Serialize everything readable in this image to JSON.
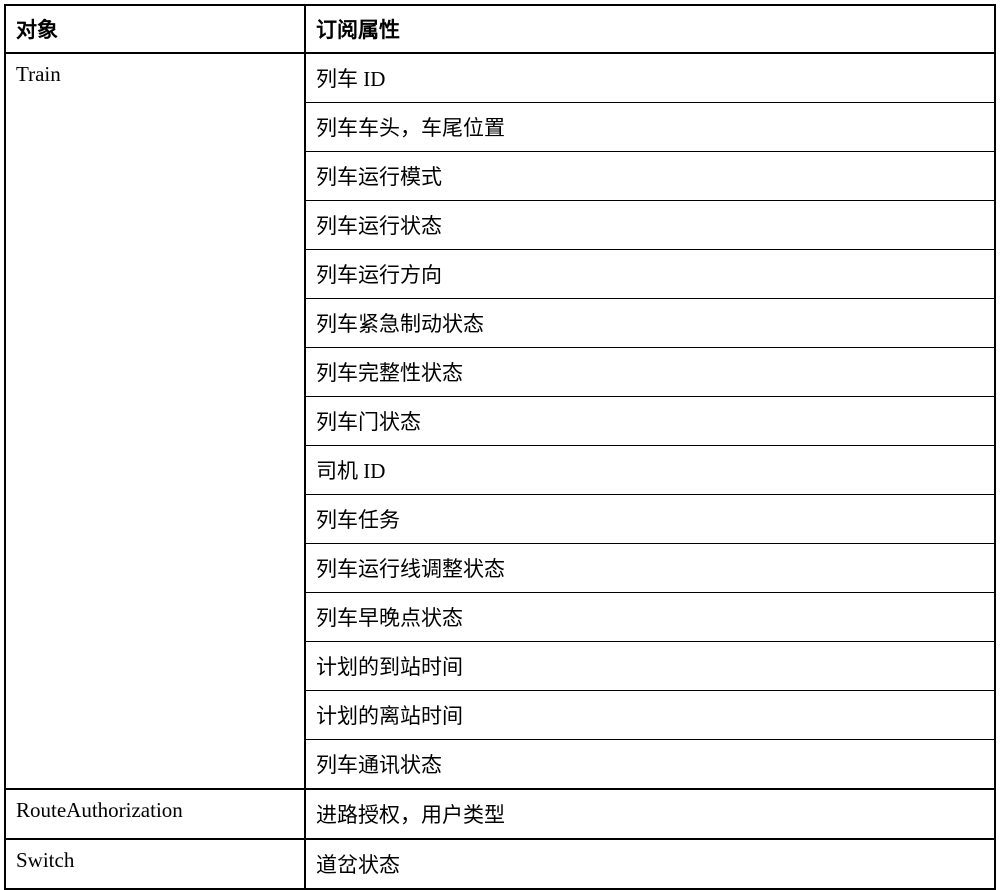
{
  "header": {
    "object_label": "对象",
    "attribute_label": "订阅属性"
  },
  "rows": [
    {
      "object": "Train",
      "attributes": [
        "列车 ID",
        "列车车头，车尾位置",
        "列车运行模式",
        "列车运行状态",
        "列车运行方向",
        "列车紧急制动状态",
        "列车完整性状态",
        "列车门状态",
        "司机 ID",
        "列车任务",
        "列车运行线调整状态",
        "列车早晚点状态",
        "计划的到站时间",
        "计划的离站时间",
        "列车通讯状态"
      ]
    },
    {
      "object": "RouteAuthorization",
      "attributes": [
        "进路授权，用户类型"
      ]
    },
    {
      "object": "Switch",
      "attributes": [
        "道岔状态"
      ]
    }
  ]
}
